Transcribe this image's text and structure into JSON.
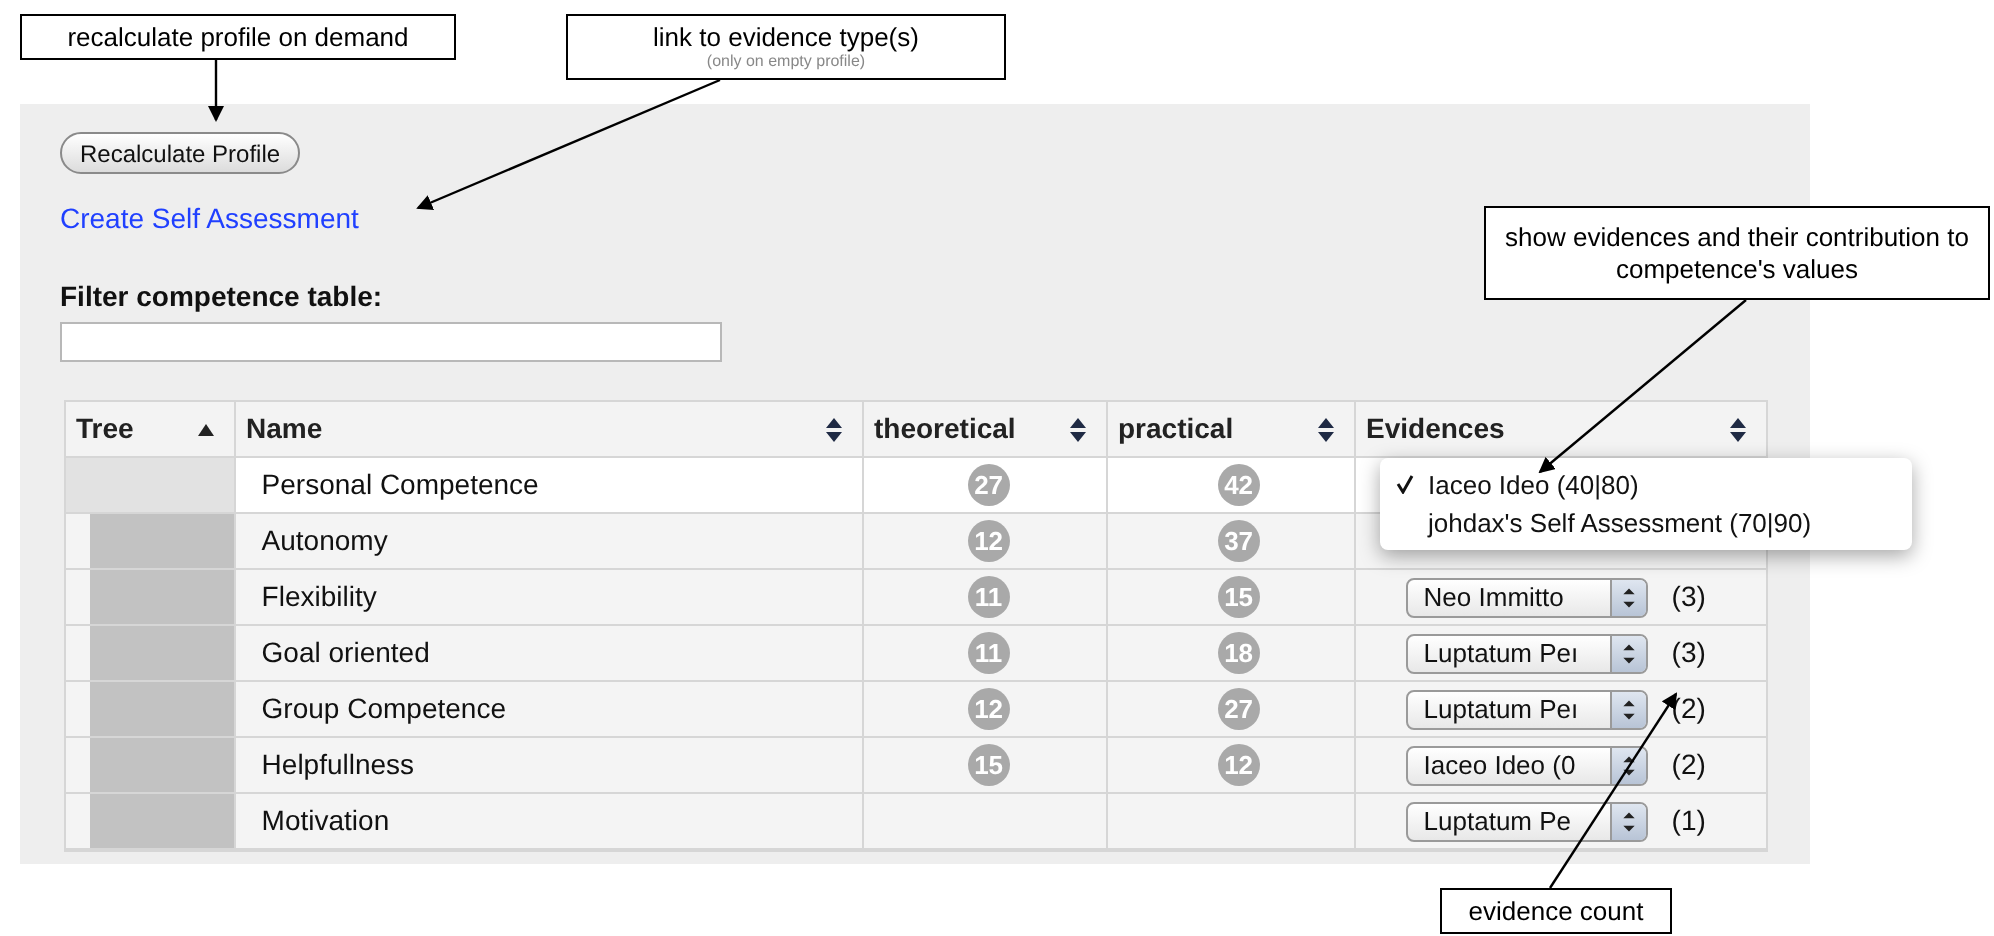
{
  "annotations": [
    {
      "text": "recalculate profile on demand"
    },
    {
      "text": "link to evidence type(s)",
      "note": "(only on empty profile)"
    },
    {
      "text": "show evidences and their contribution to competence's values"
    },
    {
      "text": "evidence count"
    }
  ],
  "recalculate_button": "Recalculate Profile",
  "create_link": "Create Self Assessment",
  "filter": {
    "label": "Filter competence table:"
  },
  "table": {
    "columns": [
      {
        "label": "Tree",
        "sorted": true
      },
      {
        "label": "Name",
        "sorted": false
      },
      {
        "label": "theoretical",
        "sorted": false
      },
      {
        "label": "practical",
        "sorted": false
      },
      {
        "label": "Evidences",
        "sorted": false
      }
    ],
    "rows": [
      {
        "name": "Personal Competence",
        "theoretical": "27",
        "practical": "42",
        "children": [
          {
            "name": "Autonomy",
            "theoretical": "12",
            "practical": "37"
          },
          {
            "name": "Flexibility",
            "theoretical": "11",
            "practical": "15",
            "evidence": "Neo Immitto",
            "count": "(3)"
          },
          {
            "name": "Goal oriented",
            "theoretical": "11",
            "practical": "18",
            "evidence": "Luptatum Peı",
            "count": "(3)"
          },
          {
            "name": "Group Competence",
            "theoretical": "12",
            "practical": "27",
            "evidence": "Luptatum Peı",
            "count": "(2)"
          },
          {
            "name": "Helpfullness",
            "theoretical": "15",
            "practical": "12",
            "evidence": "Iaceo Ideo (0",
            "count": "(2)"
          },
          {
            "name": "Motivation",
            "evidence": "Luptatum Pe",
            "count": "(1)"
          }
        ]
      }
    ]
  },
  "evidence_menu": [
    {
      "label": "Iaceo Ideo (40|80)",
      "selected": true
    },
    {
      "label": "johdax's Self Assessment (70|90)",
      "selected": false
    }
  ]
}
